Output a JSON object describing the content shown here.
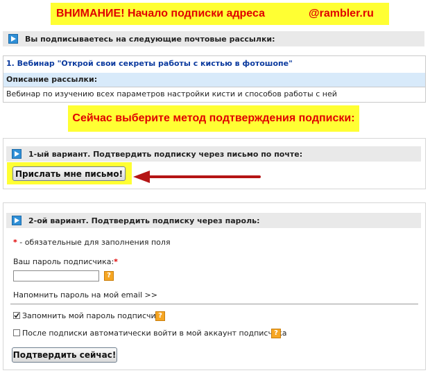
{
  "header": {
    "title_left": "ВНИМАНИЕ! Начало подписки адреса",
    "title_right": "@rambler.ru"
  },
  "subscriptions": {
    "heading": "Вы подписываетесь на следующие почтовые рассылки:",
    "item_title": "1. Вебинар \"Открой свои секреты работы с кистью в фотошопе\"",
    "description_label": "Описание рассылки:",
    "description_text": "Вебинар по изучению всех параметров настройки кисти и способов работы с ней"
  },
  "confirm_banner": "Сейчас выберите метод подтверждения подписки:",
  "option1": {
    "heading": "1-ый вариант. Подтвердить подписку через письмо по почте:",
    "button_label": "Прислать мне письмо!"
  },
  "option2": {
    "heading": "2-ой вариант. Подтвердить подписку через пароль:",
    "required_star": "*",
    "required_note": " - обязательные для заполнения поля",
    "password_label": "Ваш пароль подписчика:",
    "password_star": "*",
    "password_value": "",
    "remind_link": "Напомнить пароль на мой email >>",
    "remember_label": "Запомнить мой пароль подписчика",
    "remember_checked": true,
    "autologin_label": "После подписки автоматически войти в мой аккаунт подписчика",
    "autologin_checked": false,
    "submit_label": "Подтвердить сейчас!",
    "help_glyph": "?"
  },
  "colors": {
    "banner_bg": "#ffff33",
    "banner_text": "#e00000",
    "arrow": "#b51515",
    "link_blue": "#0b3a9e",
    "icon_blue": "#2f8fd6",
    "help_orange": "#f6a623"
  },
  "icons": [
    "play-arrow-icon",
    "help-icon",
    "check-icon",
    "red-arrow-icon"
  ]
}
